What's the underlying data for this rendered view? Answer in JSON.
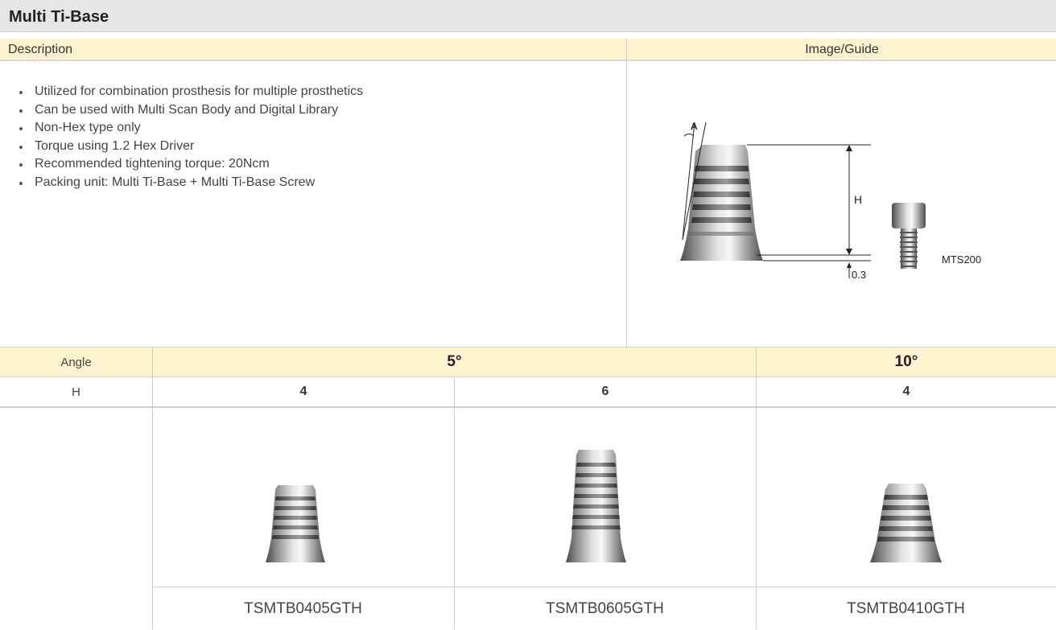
{
  "title": "Multi Ti-Base",
  "header": {
    "description": "Description",
    "image_guide": "Image/Guide"
  },
  "bullets": [
    "Utilized for combination prosthesis for multiple prosthetics",
    "Can be used with Multi Scan Body and Digital Library",
    "Non-Hex type only",
    "Torque using 1.2 Hex Driver",
    "Recommended tightening torque: 20Ncm",
    "Packing unit: Multi Ti-Base + Multi Ti-Base Screw"
  ],
  "guide": {
    "angle_label": "A",
    "height_label": "H",
    "offset_label": "0.3",
    "screw_code": "MTS200"
  },
  "table": {
    "angle_label": "Angle",
    "h_label": "H",
    "angle_5": "5°",
    "angle_10": "10°",
    "h_values": [
      "4",
      "6",
      "4"
    ],
    "codes": [
      "TSMTB0405GTH",
      "TSMTB0605GTH",
      "TSMTB0410GTH"
    ]
  },
  "colors": {
    "header_bg": "#fdf3cf",
    "title_bg": "#e6e6e6",
    "border": "#d0d0d0",
    "metal": "#9a9a9a"
  }
}
